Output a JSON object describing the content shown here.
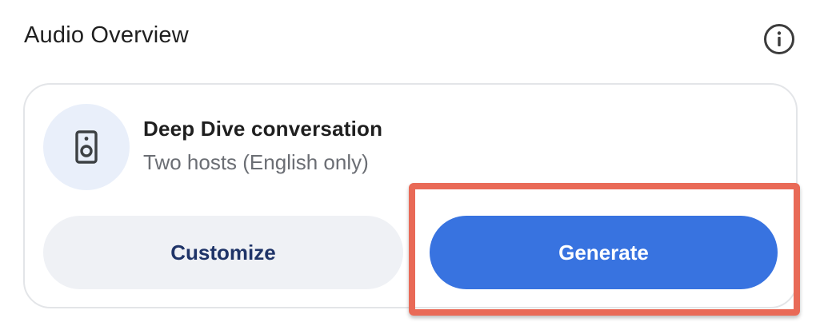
{
  "header": {
    "title": "Audio Overview",
    "info_icon": "info-icon"
  },
  "card": {
    "icon": "speaker-icon",
    "title": "Deep Dive conversation",
    "subtitle": "Two hosts (English only)",
    "customize_label": "Customize",
    "generate_label": "Generate"
  },
  "colors": {
    "primary": "#3873e0",
    "secondary_bg": "#eff1f5",
    "secondary_text": "#1f3468",
    "icon_bg": "#e9effa",
    "highlight": "#e96a57"
  }
}
